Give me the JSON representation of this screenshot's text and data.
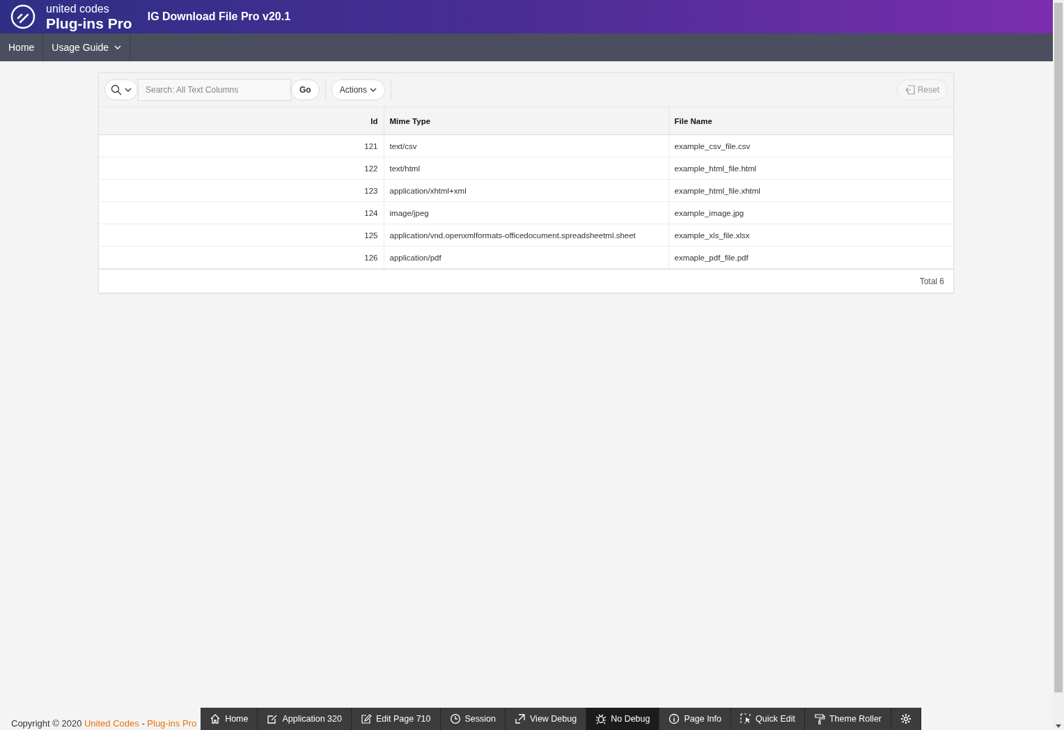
{
  "header": {
    "brand_top": "united codes",
    "brand_bottom": "Plug-ins Pro",
    "title": "IG Download File Pro v20.1"
  },
  "nav": [
    {
      "label": "Home",
      "has_menu": false
    },
    {
      "label": "Usage Guide",
      "has_menu": true
    }
  ],
  "grid_toolbar": {
    "search_placeholder": "Search: All Text Columns",
    "go": "Go",
    "actions": "Actions",
    "reset": "Reset"
  },
  "table": {
    "columns": [
      {
        "label": "Id"
      },
      {
        "label": "Mime Type"
      },
      {
        "label": "File Name"
      }
    ],
    "rows": [
      [
        "121",
        "text/csv",
        "example_csv_file.csv"
      ],
      [
        "122",
        "text/html",
        "example_html_file.html"
      ],
      [
        "123",
        "application/xhtml+xml",
        "example_html_file.xhtml"
      ],
      [
        "124",
        "image/jpeg",
        "example_image.jpg"
      ],
      [
        "125",
        "application/vnd.openxmlformats-officedocument.spreadsheetml.sheet",
        "example_xls_file.xlsx"
      ],
      [
        "126",
        "application/pdf",
        "exmaple_pdf_file.pdf"
      ]
    ],
    "total": "Total 6"
  },
  "footer": {
    "copyright": "Copyright © 2020",
    "link1": "United Codes",
    "separator": "-",
    "link2": "Plug-ins Pro"
  },
  "dev_toolbar": [
    {
      "kind": "home",
      "label": "Home",
      "on": false
    },
    {
      "kind": "application",
      "label": "Application 320",
      "on": false
    },
    {
      "kind": "edit",
      "label": "Edit Page 710",
      "on": false
    },
    {
      "kind": "session",
      "label": "Session",
      "on": false
    },
    {
      "kind": "debug-view",
      "label": "View Debug",
      "on": false
    },
    {
      "kind": "bug",
      "label": "No Debug",
      "on": true
    },
    {
      "kind": "info",
      "label": "Page Info",
      "on": false
    },
    {
      "kind": "quick-edit",
      "label": "Quick Edit",
      "on": false
    },
    {
      "kind": "roller",
      "label": "Theme Roller",
      "on": false
    },
    {
      "kind": "settings",
      "on": false
    }
  ]
}
